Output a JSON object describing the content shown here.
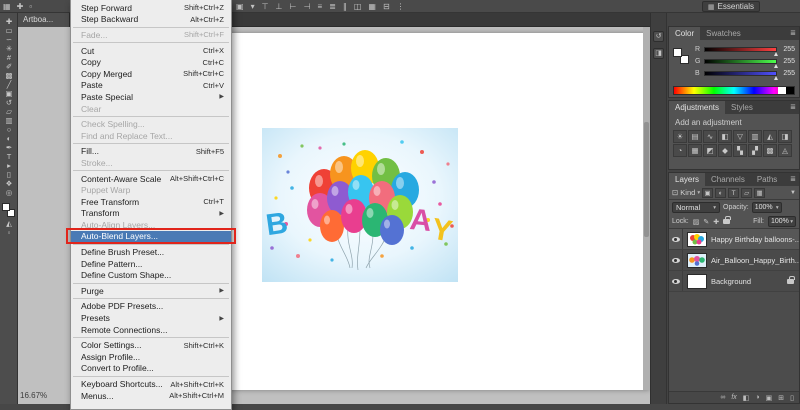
{
  "icons": {
    "submenu": "▶",
    "caret": "▾",
    "panel_menu": "≣"
  },
  "options_bar": {
    "left_icons": [
      {
        "name": "app-grid",
        "glyph": "▦"
      },
      {
        "name": "move-tool-preset",
        "glyph": "✚"
      },
      {
        "name": "tool-options",
        "glyph": "▫"
      }
    ],
    "right_icons": [
      {
        "name": "reference-point",
        "glyph": "▣"
      },
      {
        "name": "dropdown-caret",
        "glyph": "▾"
      },
      {
        "name": "align-top-edges",
        "glyph": "⊤"
      },
      {
        "name": "align-bottom-edges",
        "glyph": "⊥"
      },
      {
        "name": "align-left-edges",
        "glyph": "⊢"
      },
      {
        "name": "align-right-edges",
        "glyph": "⊣"
      },
      {
        "name": "distribute-vertical",
        "glyph": "≡"
      },
      {
        "name": "distribute-horizontal",
        "glyph": "≣"
      },
      {
        "name": "distribute-centers",
        "glyph": "∥"
      },
      {
        "name": "arrange-panels",
        "glyph": "◫"
      },
      {
        "name": "grid-view",
        "glyph": "▦"
      },
      {
        "name": "collapse",
        "glyph": "⊟"
      },
      {
        "name": "more-options",
        "glyph": "⋮"
      }
    ],
    "workspace": {
      "icon": "▦",
      "label": "Essentials"
    }
  },
  "document_tab": {
    "label": "Artboa..."
  },
  "tools": {
    "items": [
      {
        "name": "move",
        "glyph": "✚"
      },
      {
        "name": "rectangular-marquee",
        "glyph": "▭"
      },
      {
        "name": "lasso",
        "glyph": "∽"
      },
      {
        "name": "quick-selection",
        "glyph": "✳"
      },
      {
        "name": "crop",
        "glyph": "#"
      },
      {
        "name": "eyedropper",
        "glyph": "✐"
      },
      {
        "name": "spot-healing",
        "glyph": "▩"
      },
      {
        "name": "brush",
        "glyph": "╱"
      },
      {
        "name": "clone-stamp",
        "glyph": "▣"
      },
      {
        "name": "history-brush",
        "glyph": "↺"
      },
      {
        "name": "eraser",
        "glyph": "▱"
      },
      {
        "name": "gradient",
        "glyph": "▥"
      },
      {
        "name": "blur",
        "glyph": "○"
      },
      {
        "name": "dodge",
        "glyph": "◐"
      },
      {
        "name": "pen",
        "glyph": "✒"
      },
      {
        "name": "type",
        "glyph": "T"
      },
      {
        "name": "path-selection",
        "glyph": "▸"
      },
      {
        "name": "rectangle",
        "glyph": "▯"
      },
      {
        "name": "hand",
        "glyph": "❖"
      },
      {
        "name": "zoom",
        "glyph": "◎"
      }
    ],
    "quick_mask_glyph": "◭",
    "screen_mode_glyph": "▫"
  },
  "menu": {
    "items": [
      {
        "label": "Step Forward",
        "shortcut": "Shift+Ctrl+Z",
        "state": "enabled"
      },
      {
        "label": "Step Backward",
        "shortcut": "Alt+Ctrl+Z",
        "state": "enabled"
      },
      {
        "type": "separator"
      },
      {
        "label": "Fade...",
        "shortcut": "Shift+Ctrl+F",
        "state": "disabled"
      },
      {
        "type": "separator"
      },
      {
        "label": "Cut",
        "shortcut": "Ctrl+X",
        "state": "enabled"
      },
      {
        "label": "Copy",
        "shortcut": "Ctrl+C",
        "state": "enabled"
      },
      {
        "label": "Copy Merged",
        "shortcut": "Shift+Ctrl+C",
        "state": "enabled"
      },
      {
        "label": "Paste",
        "shortcut": "Ctrl+V",
        "state": "enabled"
      },
      {
        "label": "Paste Special",
        "submenu": true,
        "state": "enabled"
      },
      {
        "label": "Clear",
        "state": "disabled"
      },
      {
        "type": "separator"
      },
      {
        "label": "Check Spelling...",
        "state": "disabled"
      },
      {
        "label": "Find and Replace Text...",
        "state": "disabled"
      },
      {
        "type": "separator"
      },
      {
        "label": "Fill...",
        "shortcut": "Shift+F5",
        "state": "enabled"
      },
      {
        "label": "Stroke...",
        "state": "disabled"
      },
      {
        "type": "separator"
      },
      {
        "label": "Content-Aware Scale",
        "shortcut": "Alt+Shift+Ctrl+C",
        "state": "enabled"
      },
      {
        "label": "Puppet Warp",
        "state": "disabled"
      },
      {
        "label": "Free Transform",
        "shortcut": "Ctrl+T",
        "state": "enabled"
      },
      {
        "label": "Transform",
        "submenu": true,
        "state": "enabled"
      },
      {
        "label": "Auto-Align Layers...",
        "state": "disabled"
      },
      {
        "label": "Auto-Blend Layers...",
        "state": "highlighted"
      },
      {
        "type": "separator"
      },
      {
        "label": "Define Brush Preset...",
        "state": "enabled"
      },
      {
        "label": "Define Pattern...",
        "state": "enabled"
      },
      {
        "label": "Define Custom Shape...",
        "state": "enabled"
      },
      {
        "type": "separator"
      },
      {
        "label": "Purge",
        "submenu": true,
        "state": "enabled"
      },
      {
        "type": "separator"
      },
      {
        "label": "Adobe PDF Presets...",
        "state": "enabled"
      },
      {
        "label": "Presets",
        "submenu": true,
        "state": "enabled"
      },
      {
        "label": "Remote Connections...",
        "state": "enabled"
      },
      {
        "type": "separator"
      },
      {
        "label": "Color Settings...",
        "shortcut": "Shift+Ctrl+K",
        "state": "enabled"
      },
      {
        "label": "Assign Profile...",
        "state": "enabled"
      },
      {
        "label": "Convert to Profile...",
        "state": "enabled"
      },
      {
        "type": "separator"
      },
      {
        "label": "Keyboard Shortcuts...",
        "shortcut": "Alt+Shift+Ctrl+K",
        "state": "enabled"
      },
      {
        "label": "Menus...",
        "shortcut": "Alt+Shift+Ctrl+M",
        "state": "enabled"
      }
    ],
    "highlight_color": "#e1251b"
  },
  "artwork": {
    "letter_b": "B",
    "letter_a": "A",
    "letter_y": "Y"
  },
  "status": {
    "zoom": "16.67%"
  },
  "panels": {
    "collapsed": [
      {
        "name": "history",
        "glyph": "↺"
      },
      {
        "name": "properties",
        "glyph": "◨"
      }
    ],
    "color": {
      "tabs": [
        "Color",
        "Swatches"
      ],
      "active_tab": "Color",
      "channels": [
        {
          "label": "R",
          "value": "255"
        },
        {
          "label": "G",
          "value": "255"
        },
        {
          "label": "B",
          "value": "255"
        }
      ]
    },
    "adjustments": {
      "tabs": [
        "Adjustments",
        "Styles"
      ],
      "active_tab": "Adjustments",
      "header": "Add an adjustment",
      "icons": [
        {
          "name": "brightness-contrast",
          "glyph": "☀"
        },
        {
          "name": "levels",
          "glyph": "▤"
        },
        {
          "name": "curves",
          "glyph": "∿"
        },
        {
          "name": "exposure",
          "glyph": "◧"
        },
        {
          "name": "vibrance",
          "glyph": "▽"
        },
        {
          "name": "hue-saturation",
          "glyph": "▥"
        },
        {
          "name": "color-balance",
          "glyph": "◭"
        },
        {
          "name": "black-white",
          "glyph": "◨"
        },
        {
          "name": "photo-filter",
          "glyph": "◔"
        },
        {
          "name": "channel-mixer",
          "glyph": "▦"
        },
        {
          "name": "color-lookup",
          "glyph": "◩"
        },
        {
          "name": "invert",
          "glyph": "◆"
        },
        {
          "name": "posterize",
          "glyph": "▚"
        },
        {
          "name": "threshold",
          "glyph": "▞"
        },
        {
          "name": "gradient-map",
          "glyph": "▩"
        },
        {
          "name": "selective-color",
          "glyph": "◬"
        }
      ]
    },
    "layers": {
      "tabs": [
        "Layers",
        "Channels",
        "Paths"
      ],
      "active_tab": "Layers",
      "filter": {
        "picker_glyph": "⊡",
        "kind": "Kind",
        "icons": [
          {
            "name": "pixel-layer-filter",
            "glyph": "▣"
          },
          {
            "name": "adjustment-layer-filter",
            "glyph": "◐"
          },
          {
            "name": "type-layer-filter",
            "glyph": "T"
          },
          {
            "name": "shape-layer-filter",
            "glyph": "▱"
          },
          {
            "name": "smart-object-filter",
            "glyph": "▦"
          }
        ],
        "funnel": "▼"
      },
      "blend_mode": "Normal",
      "opacity_label": "Opacity:",
      "opacity": "100%",
      "lock_label": "Lock:",
      "lock_icons": [
        {
          "name": "lock-transparent-pixels",
          "glyph": "▨"
        },
        {
          "name": "lock-image-pixels",
          "glyph": "✎"
        },
        {
          "name": "lock-position",
          "glyph": "✚"
        }
      ],
      "fill_label": "Fill:",
      "fill": "100%",
      "rows": [
        {
          "name": "Happy Birthday balloons-...",
          "visible": true,
          "selected": true
        },
        {
          "name": "Air_Balloon_Happy_Birth...",
          "visible": true
        },
        {
          "name": "Background",
          "visible": true,
          "locked": true
        }
      ],
      "bottom_icons": [
        {
          "name": "link-layers",
          "glyph": "∞"
        },
        {
          "name": "layer-effects",
          "glyph": "fx"
        },
        {
          "name": "layer-mask",
          "glyph": "◧"
        },
        {
          "name": "adjustment-layer",
          "glyph": "◑"
        },
        {
          "name": "layer-group",
          "glyph": "▣"
        },
        {
          "name": "new-layer",
          "glyph": "⊞"
        },
        {
          "name": "delete-layer",
          "glyph": "▯"
        }
      ]
    }
  }
}
